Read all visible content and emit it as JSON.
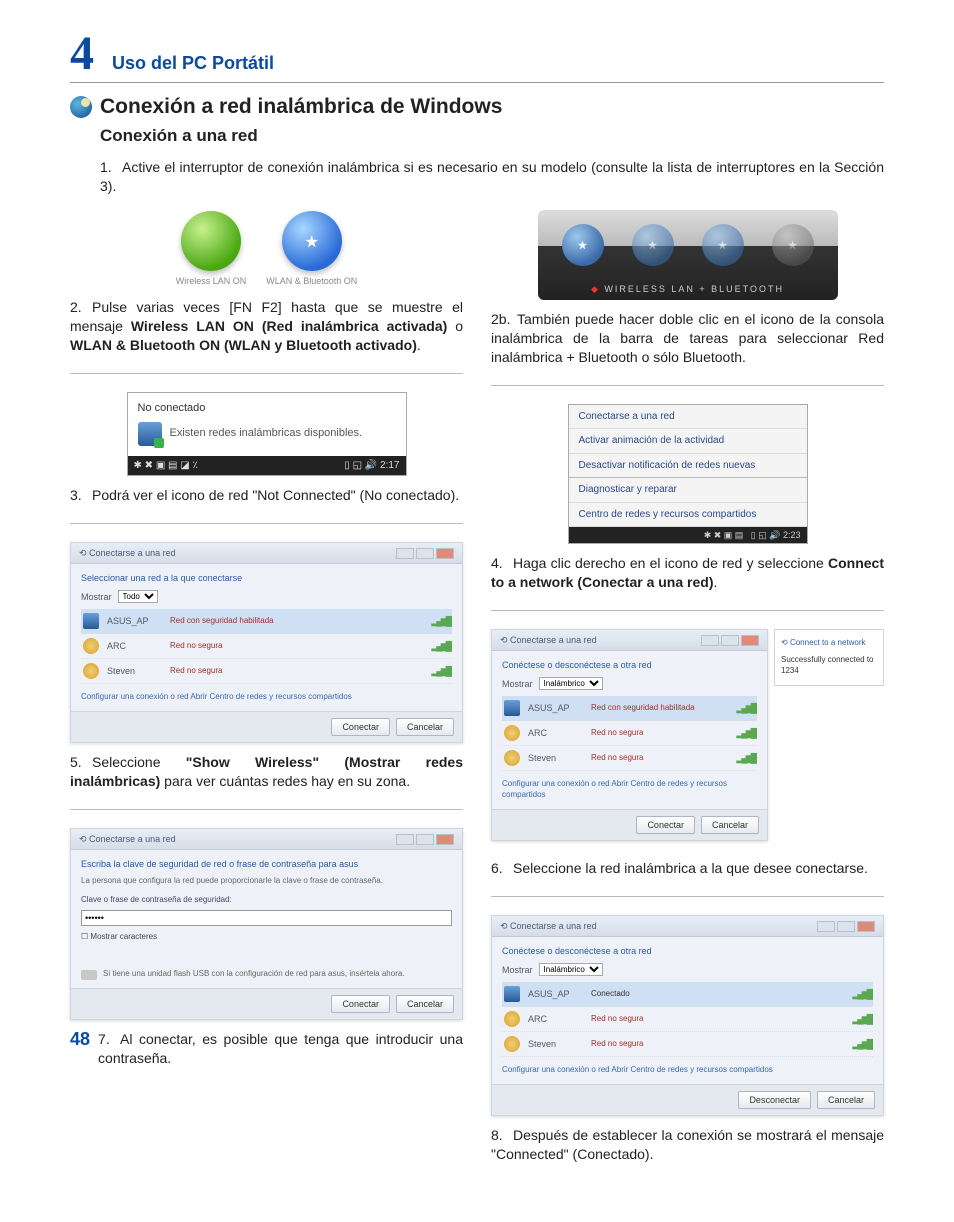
{
  "chapter": {
    "number": "4",
    "title": "Uso del PC Portátil"
  },
  "section": {
    "h1": "Conexión a red inalámbrica de Windows",
    "h2": "Conexión a una red"
  },
  "page_number": "48",
  "steps": {
    "s1": {
      "n": "1.",
      "text": "Active el interruptor de conexión inalámbrica si es necesario en su modelo (consulte la lista de interruptores en la Sección 3)."
    },
    "s2": {
      "n": "2.",
      "pre": "Pulse varias veces [FN F2] hasta que se muestre el mensaje ",
      "bold": "Wireless LAN ON (Red inalámbrica activada)",
      "mid": " o ",
      "bold2": "WLAN & Bluetooth ON (WLAN y Bluetooth activado)",
      "post": "."
    },
    "s2b": {
      "n": "2b.",
      "text": "También puede hacer doble clic en el icono de la consola inalámbrica de la barra de tareas para seleccionar Red inalámbrica + Bluetooth o sólo Bluetooth."
    },
    "s3": {
      "n": "3.",
      "text": "Podrá ver el icono de red \"Not Connected\" (No conectado)."
    },
    "s4": {
      "n": "4.",
      "pre": "Haga clic derecho en el icono de red y seleccione ",
      "bold": "Connect to a network (Conectar a una red)",
      "post": "."
    },
    "s5": {
      "n": "5.",
      "pre": "Seleccione ",
      "bold": "\"Show Wireless\" (Mostrar redes inalámbricas)",
      "post": " para ver cuántas redes hay en su zona."
    },
    "s6": {
      "n": "6.",
      "text": "Seleccione la red inalámbrica a la que desee conectarse."
    },
    "s7": {
      "n": "7.",
      "text": "Al conectar, es posible que tenga que introducir una contraseña."
    },
    "s8": {
      "n": "8.",
      "text": "Después de establecer la conexión se mostrará el mensaje \"Connected\" (Conectado)."
    }
  },
  "figures": {
    "orbs": {
      "left_caption": "Wireless LAN ON",
      "right_caption": "WLAN & Bluetooth ON"
    },
    "bar_caption": "WIRELESS LAN + BLUETOOTH",
    "tray": {
      "title": "No conectado",
      "msg": "Existen redes inalámbricas disponibles.",
      "time": "2:17"
    },
    "context_menu": {
      "i1": "Conectarse a una red",
      "i2": "Activar animación de la actividad",
      "i3": "Desactivar notificación de redes nuevas",
      "i4": "Diagnosticar y reparar",
      "i5": "Centro de redes y recursos compartidos",
      "time": "2:23"
    },
    "netwin": {
      "title": "Conectarse a una red",
      "prompt_select": "Seleccionar una red a la que conectarse",
      "prompt_disc": "Conéctese o desconéctese a otra red",
      "prompt_disc2": "Conéctese o desconéctese a otra red",
      "filter_label": "Mostrar",
      "filter_all": "Todo",
      "filter_wireless": "Inalámbrico",
      "net1_ssid": "ASUS_AP",
      "net1_sec": "Red con seguridad habilitada",
      "net2_ssid": "ARC",
      "net2_sec": "Red no segura",
      "net3_ssid": "Steven",
      "net3_sec": "Red no segura",
      "connected": "Conectado",
      "links": "Configurar una conexión o red\nAbrir Centro de redes y recursos compartidos",
      "btn_connect": "Conectar",
      "btn_cancel": "Cancelar",
      "btn_disconnect": "Desconectar"
    },
    "balloon": {
      "title": "Connect to a network",
      "msg": "Successfully connected to 1234"
    },
    "pwd": {
      "title": "Conectarse a una red",
      "heading": "Escriba la clave de seguridad de red o frase de contraseña para asus",
      "sub": "La persona que configura la red puede proporcionarle la clave o frase de contraseña.",
      "label": "Clave o frase de contraseña de seguridad:",
      "value": "••••••",
      "checkbox": "Mostrar caracteres",
      "hint": "Si tiene una unidad flash USB con la configuración de red para asus, insértela ahora.",
      "btn_connect": "Conectar",
      "btn_cancel": "Cancelar"
    }
  }
}
